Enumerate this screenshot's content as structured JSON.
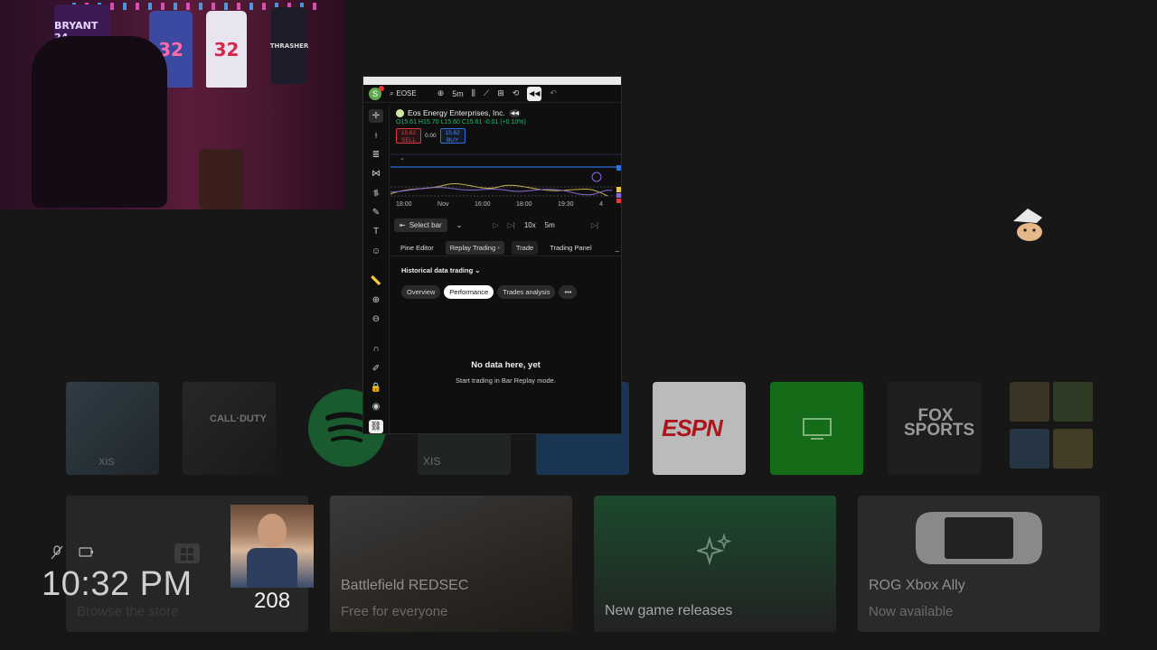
{
  "overlay": {
    "clock": "10:32 PM",
    "count": "208"
  },
  "webcam": {
    "jerseys": [
      "BRYANT 24",
      "32",
      "32",
      "THRASHER"
    ]
  },
  "tiles_row1": [
    {
      "name": "tile-game-1",
      "label": "XIS"
    },
    {
      "name": "tile-call-of-duty",
      "label": "CALL·DUTY"
    },
    {
      "name": "tile-spotify",
      "label": ""
    },
    {
      "name": "tile-game-xis",
      "label": "XIS"
    },
    {
      "name": "tile-blue",
      "label": ""
    },
    {
      "name": "tile-espn",
      "label": "ESPN"
    },
    {
      "name": "tile-tv",
      "label": ""
    },
    {
      "name": "tile-fox-sports",
      "label": "FOX SPORTS"
    },
    {
      "name": "tile-group",
      "label": ""
    }
  ],
  "cards": {
    "store": {
      "title": "",
      "subtitle": "Browse the store"
    },
    "battlefield": {
      "title": "Battlefield REDSEC",
      "subtitle": "Free for everyone"
    },
    "new_releases": {
      "title": "New game releases",
      "subtitle": ""
    },
    "rog": {
      "title": "ROG Xbox Ally",
      "subtitle": "Now available"
    }
  },
  "tradingview": {
    "symbol_search": "EOSE",
    "interval": "5m",
    "symbol_name": "Eos Energy Enterprises, Inc.",
    "ohlc": {
      "o": "O15.61",
      "h": "H15.70",
      "l": "L15.60",
      "c": "C15.61",
      "chg": "-0.01 (+0.10%)"
    },
    "sell_price": "15.62",
    "sell_label": "SELL",
    "spread": "0.00",
    "buy_price": "15.62",
    "buy_label": "BUY",
    "xaxis": [
      "18:00",
      "Nov",
      "16:00",
      "18:00",
      "19:30",
      "4"
    ],
    "select_bar": "Select bar",
    "speed": "10x",
    "replay_interval": "5m",
    "tabs": [
      "Pine Editor",
      "Replay Trading",
      "Trade",
      "Trading Panel"
    ],
    "section": "Historical data trading",
    "pills": [
      "Overview",
      "Performance",
      "Trades analysis"
    ],
    "empty_title": "No data here, yet",
    "empty_sub": "Start trading in Bar Replay mode.",
    "colors": {
      "sell": "#e0393e",
      "buy": "#2f6fe0",
      "up": "#2bb673"
    }
  }
}
